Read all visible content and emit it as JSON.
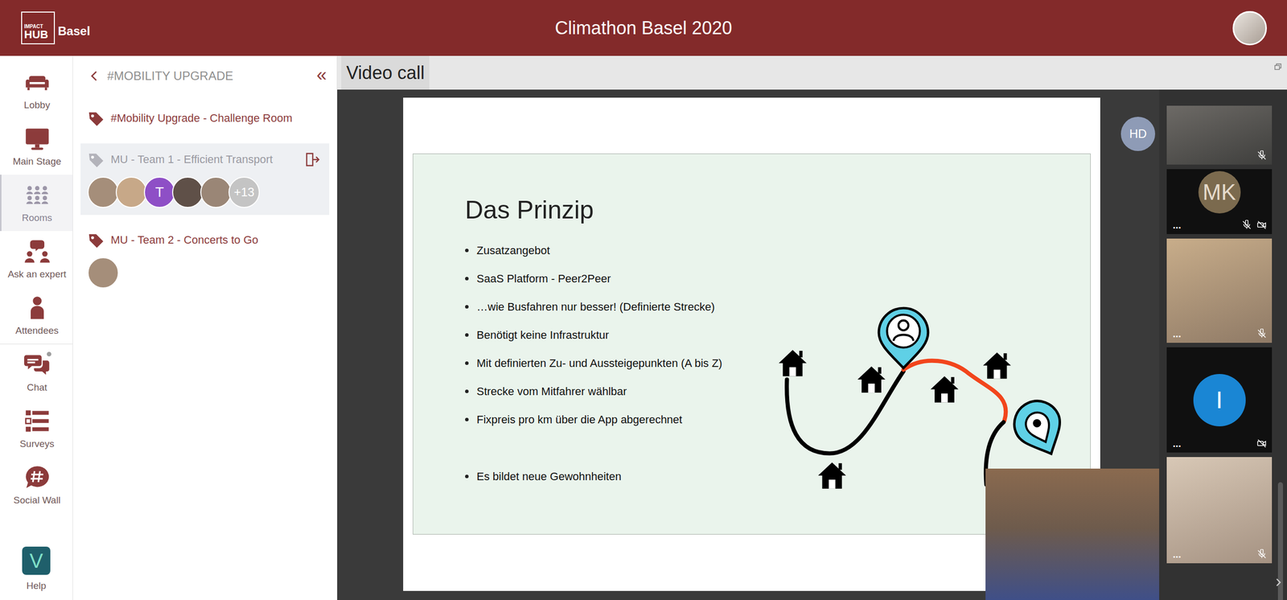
{
  "top_bar": {
    "logo": {
      "small": "IMPACT",
      "big": "HUB",
      "city": "Basel"
    },
    "title": "Climathon Basel 2020"
  },
  "nav": {
    "items": [
      {
        "label": "Lobby",
        "selected": false,
        "badge": false
      },
      {
        "label": "Main Stage",
        "selected": false,
        "badge": false
      },
      {
        "label": "Rooms",
        "selected": true,
        "badge": false
      },
      {
        "label": "Ask an expert",
        "selected": false,
        "badge": false
      },
      {
        "label": "Attendees",
        "selected": false,
        "badge": false
      },
      {
        "label": "Chat",
        "selected": false,
        "badge": true
      },
      {
        "label": "Surveys",
        "selected": false,
        "badge": false
      },
      {
        "label": "Social Wall",
        "selected": false,
        "badge": false
      }
    ],
    "help": {
      "label": "Help",
      "glyph": "V"
    }
  },
  "rooms_panel": {
    "header": "#MOBILITY UPGRADE",
    "collapse": "«",
    "rooms": [
      {
        "name": "#Mobility Upgrade - Challenge Room",
        "selected": false,
        "can_leave": false,
        "avatars": []
      },
      {
        "name": "MU - Team 1 - Efficient Transport",
        "selected": true,
        "can_leave": true,
        "avatars": [
          {
            "kind": "photo"
          },
          {
            "kind": "photo"
          },
          {
            "kind": "initial",
            "text": "T",
            "color": "#8e4fc6"
          },
          {
            "kind": "photo"
          },
          {
            "kind": "photo"
          },
          {
            "kind": "count",
            "text": "+13"
          }
        ]
      },
      {
        "name": "MU - Team 2 - Concerts to Go",
        "selected": false,
        "can_leave": false,
        "avatars": [
          {
            "kind": "photo"
          }
        ]
      }
    ]
  },
  "video": {
    "tab": "Video call",
    "slide": {
      "title": "Das Prinzip",
      "bullets": [
        "Zusatzangebot",
        "SaaS Platform - Peer2Peer",
        "…wie Busfahren nur besser! (Definierte Strecke)",
        "Benötigt keine Infrastruktur",
        "Mit definierten Zu- und Aussteigepunkten (A bis Z)",
        "Strecke vom Mitfahrer wählbar",
        "Fixpreis pro km über die App abgerechnet"
      ],
      "closing_bullets": [
        "Es bildet neue Gewohnheiten"
      ]
    },
    "presenter": {
      "initials": "HD"
    },
    "participants": [
      {
        "kind": "video",
        "mic_muted": true,
        "camera_off": false
      },
      {
        "kind": "initials",
        "initials": "MK",
        "color": "#7b6a4e",
        "mic_muted": true,
        "camera_off": true,
        "menu": "..."
      },
      {
        "kind": "video",
        "mic_muted": true,
        "camera_off": false,
        "menu": "..."
      },
      {
        "kind": "initials",
        "initials": "I",
        "color": "#1a86d4",
        "mic_muted": false,
        "camera_off": true,
        "menu": "..."
      },
      {
        "kind": "video",
        "mic_muted": true,
        "camera_off": false,
        "menu": "..."
      }
    ]
  }
}
